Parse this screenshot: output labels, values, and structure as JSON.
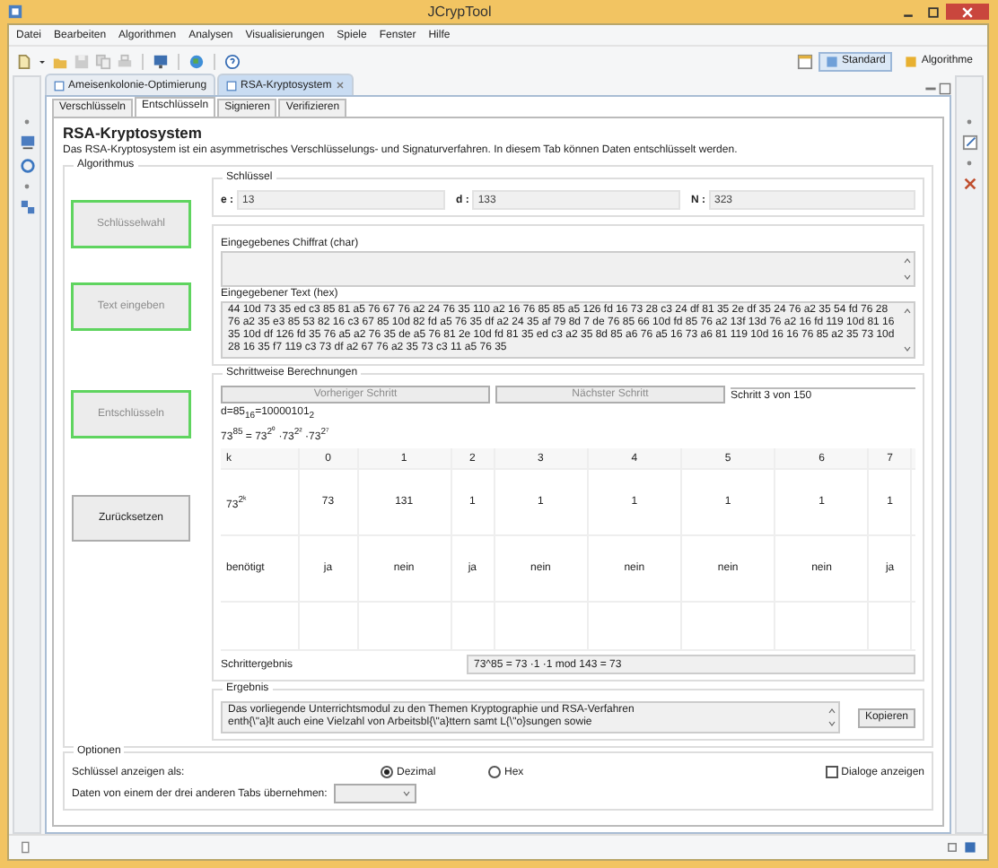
{
  "window": {
    "title": "JCrypTool"
  },
  "menu": [
    "Datei",
    "Bearbeiten",
    "Algorithmen",
    "Analysen",
    "Visualisierungen",
    "Spiele",
    "Fenster",
    "Hilfe"
  ],
  "perspectives": [
    {
      "label": "Standard",
      "selected": true
    },
    {
      "label": "Algorithme",
      "selected": false
    }
  ],
  "editor_tabs": [
    {
      "label": "Ameisenkolonie-Optimierung",
      "selected": false
    },
    {
      "label": "RSA-Kryptosystem",
      "selected": true
    }
  ],
  "tabs": [
    {
      "label": "Verschlüsseln",
      "selected": false
    },
    {
      "label": "Entschlüsseln",
      "selected": true
    },
    {
      "label": "Signieren",
      "selected": false
    },
    {
      "label": "Verifizieren",
      "selected": false
    }
  ],
  "heading": "RSA-Kryptosystem",
  "description": "Das RSA-Kryptosystem ist ein asymmetrisches Verschlüsselungs- und Signaturverfahren. In diesem Tab können Daten entschlüsselt werden.",
  "algorithm": {
    "title": "Algorithmus",
    "buttons": [
      {
        "label": "Schlüsselwahl",
        "disabled": true,
        "highlighted": true
      },
      {
        "label": "Text eingeben",
        "disabled": true,
        "highlighted": true
      },
      {
        "label": "Entschlüsseln",
        "disabled": true,
        "highlighted": true
      },
      {
        "label": "Zurücksetzen",
        "disabled": false,
        "highlighted": false
      }
    ],
    "key": {
      "title": "Schlüssel",
      "fields": [
        {
          "label": "e :",
          "value": "13"
        },
        {
          "label": "d :",
          "value": "133"
        },
        {
          "label": "N :",
          "value": "323"
        }
      ]
    },
    "cipher": {
      "label": "Eingegebenes Chiffrat (char)"
    },
    "text": {
      "label": "Eingegebener Text (hex)",
      "value": "44 10d 73 35 ed c3 85 81 a5 76 67 76 a2 24 76 35 110 a2 16 76 85 85 a5 126 fd 16 73 28 c3 24 df 81 35 2e df 35 24 76 a2 35 54 fd 76 28 76 a2 35 e3 85 53 82 16 c3 67 85 10d 82 fd a5 76 35 df a2 24 35 af 79 8d 7 de 76 85 66 10d fd 85 76 a2 13f 13d 76 a2 16 fd 119 10d 81 16 35 10d df 126 fd 35 76 a5 a2 76 35 de a5 76 81 2e 10d fd 81 35 ed c3 a2 35 8d 85 a6 76 a5 16 73 a6 81 119 10d 16 16 76 85 a2 35 73 10d 28 16 35 f7 119 c3 73 df a2 67 76 a2 35 73 c3 11 a5 76 35"
    },
    "steps": {
      "title": "Schrittweise Berechnungen",
      "prev": {
        "label": "Vorheriger Schritt",
        "disabled": true
      },
      "next": {
        "label": "Nächster Schritt",
        "disabled": true
      },
      "counter": "Schritt 3 von 150",
      "d_binary": "d=85$_{16}$=10000101$_{2}$",
      "formula": "73$^{85}$ = 73$^{2⁰}$ ·73$^{2²}$ ·73$^{2⁷}$",
      "table": [
        [
          "k",
          "0",
          "1",
          "2",
          "3",
          "4",
          "5",
          "6",
          "7"
        ],
        [
          "73$^{2ᵏ}$",
          "73",
          "131",
          "1",
          "1",
          "1",
          "1",
          "1",
          "1"
        ],
        [
          "benötigt",
          "ja",
          "nein",
          "ja",
          "nein",
          "nein",
          "nein",
          "nein",
          "ja"
        ]
      ],
      "result_label": "Schrittergebnis",
      "result": "73^85 = 73 ·1 ·1 mod 143 = 73"
    },
    "result": {
      "title": "Ergebnis",
      "value": "Das vorliegende Unterrichtsmodul zu den Themen Kryptographie und RSA-Verfahren\nenth{\\\"a}lt auch eine Vielzahl von Arbeitsbl{\\\"a}ttern samt L{\\\"o}sungen sowie",
      "copy_button": "Kopieren"
    }
  },
  "options": {
    "title": "Optionen",
    "show_key_label": "Schlüssel anzeigen als:",
    "radios": [
      {
        "label": "Dezimal",
        "selected": true
      },
      {
        "label": "Hex",
        "selected": false
      }
    ],
    "dialogs": {
      "label": "Dialoge anzeigen",
      "checked": false
    },
    "import_label": "Daten von einem der drei anderen Tabs übernehmen:"
  }
}
